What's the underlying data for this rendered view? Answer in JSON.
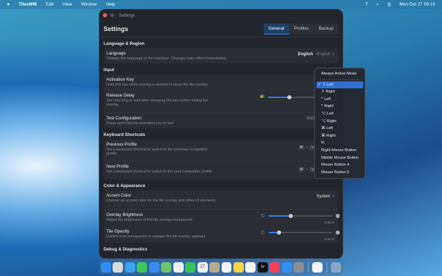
{
  "menubar": {
    "app": "TilesWM",
    "items": [
      "Edit",
      "View",
      "Window",
      "Help"
    ],
    "clock": "Mon Oct 27  09:19"
  },
  "window": {
    "title": "Settings",
    "heading": "Settings",
    "tabs": [
      "General",
      "Profiles",
      "Backup"
    ],
    "active_tab": "General"
  },
  "sections": {
    "language": {
      "title": "Language & Region",
      "label": "Language",
      "desc": "Change the language of the interface. Changes take effect immediately.",
      "value": "English",
      "value_sub": "- English"
    },
    "input": {
      "title": "Input",
      "activation": {
        "label": "Activation Key",
        "desc": "Hold this key while moving a window to show the tile overlay."
      },
      "release": {
        "label": "Release Delay",
        "desc": "Set how long to wait after releasing the key before hiding the overlay",
        "value": 0.3
      },
      "test": {
        "label": "Test Configuration",
        "desc": "Press and hold the activation key to test",
        "status": "Waitin"
      }
    },
    "shortcuts": {
      "title": "Keyboard Shortcuts",
      "prev": {
        "label": "Previous Profile",
        "desc": "Set a keyboard shortcut to switch to the previous compatible profile.",
        "keys": [
          "⌘",
          "⌥",
          "["
        ]
      },
      "next": {
        "label": "Next Profile",
        "desc": "Set a keyboard shortcut to switch to the next compatible profile.",
        "keys": [
          "⌘",
          "⌥",
          "]"
        ]
      }
    },
    "appearance": {
      "title": "Color & Appearance",
      "accent": {
        "label": "Accent Color",
        "desc": "Choose an accent color for the tile overlay and other UI elements.",
        "value": "System"
      },
      "brightness": {
        "label": "Overlay Brightness",
        "desc": "Adjust the brightness of the tile overlay background",
        "value_text": "0.33 %",
        "value": 0.33
      },
      "opacity": {
        "label": "Tile Opacity",
        "desc": "Control how transparent or opaque the tile overlay appears",
        "value_text": "0.15 %",
        "value": 0.15
      }
    },
    "debug": {
      "title": "Debug & Diagnostics"
    }
  },
  "dropdown": {
    "header": "Always Active Mode",
    "selected": "⇧ Left",
    "items": [
      "⇧ Left",
      "⇧ Right",
      "^ Left",
      "^ Right",
      "⌥ Left",
      "⌥ Right",
      "⌘ Left",
      "⌘ Right",
      "fn",
      "Right Mouse Button",
      "Middle Mouse Button",
      "Mouse Button 4",
      "Mouse Button 5"
    ]
  },
  "dock": {
    "apps": [
      "finder",
      "launchpad",
      "safari",
      "messages",
      "mail",
      "maps",
      "photos",
      "facetime",
      "calendar",
      "contacts",
      "reminders",
      "notes",
      "freeform",
      "tv",
      "music",
      "app-store",
      "system-settings",
      "tiles",
      "trash"
    ],
    "calendar_day": "27",
    "tv_label": "tv"
  },
  "colors": {
    "accent": "#2f7cf6",
    "window_bg": "#22252c",
    "card_bg": "#2a2d34"
  }
}
